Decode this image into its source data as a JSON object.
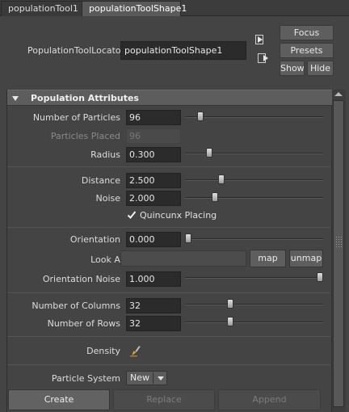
{
  "tabs": [
    {
      "label": "populationTool1"
    },
    {
      "label": "populationToolShape1"
    }
  ],
  "header": {
    "locator_label": "PopulationToolLocator:",
    "locator_value": "populationToolShape1",
    "focus_label": "Focus",
    "presets_label": "Presets",
    "show_label": "Show",
    "hide_label": "Hide"
  },
  "section": {
    "title": "Population Attributes"
  },
  "fields": {
    "number_of_particles": {
      "label": "Number of Particles",
      "value": "96",
      "slider_fraction": 0.09
    },
    "particles_placed": {
      "label": "Particles Placed",
      "value": "96"
    },
    "radius": {
      "label": "Radius",
      "value": "0.300",
      "slider_fraction": 0.16
    },
    "distance": {
      "label": "Distance",
      "value": "2.500",
      "slider_fraction": 0.25
    },
    "noise": {
      "label": "Noise",
      "value": "2.000",
      "slider_fraction": 0.2
    },
    "quincunx": {
      "label": "Quincunx Placing",
      "checked": true
    },
    "orientation": {
      "label": "Orientation",
      "value": "0.000",
      "slider_fraction": 0.0
    },
    "look_at": {
      "label": "Look At",
      "value": "",
      "map_label": "map",
      "unmap_label": "unmap"
    },
    "orientation_noise": {
      "label": "Orientation Noise",
      "value": "1.000",
      "slider_fraction": 1.0
    },
    "number_of_columns": {
      "label": "Number of Columns",
      "value": "32",
      "slider_fraction": 0.32
    },
    "number_of_rows": {
      "label": "Number of Rows",
      "value": "32",
      "slider_fraction": 0.32
    },
    "density": {
      "label": "Density",
      "icon": "paint-brush-icon"
    },
    "particle_system": {
      "label": "Particle System",
      "selected": "New"
    }
  },
  "actions": {
    "create_label": "Create",
    "replace_label": "Replace",
    "append_label": "Append"
  },
  "colors": {
    "background": "#444444",
    "field": "#2b2b2b",
    "header": "#5d5d5d"
  }
}
